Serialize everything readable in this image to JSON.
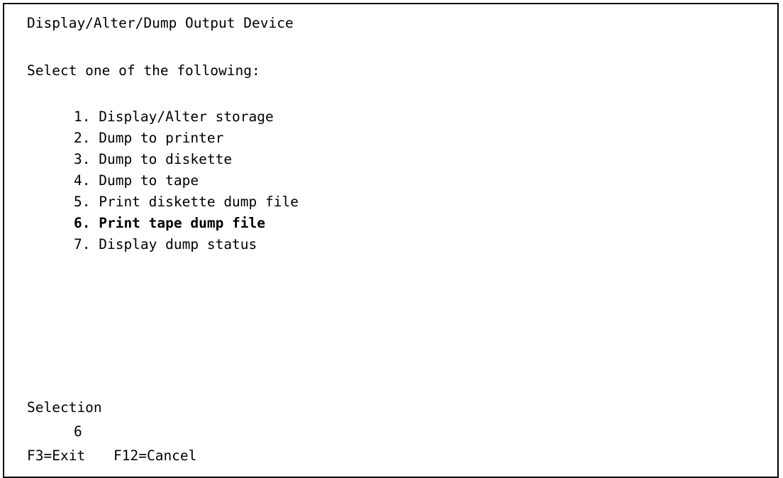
{
  "screen": {
    "title": "Display/Alter/Dump Output Device",
    "prompt": "Select one of the following:",
    "options": [
      {
        "label": "1. Display/Alter storage",
        "selected": false
      },
      {
        "label": "2. Dump to printer",
        "selected": false
      },
      {
        "label": "3. Dump to diskette",
        "selected": false
      },
      {
        "label": "4. Dump to tape",
        "selected": false
      },
      {
        "label": "5. Print diskette dump file",
        "selected": false
      },
      {
        "label": "6. Print tape dump file",
        "selected": true
      },
      {
        "label": "7. Display dump status",
        "selected": false
      }
    ],
    "selection_label": "Selection",
    "selection_value": "6",
    "function_keys": {
      "exit": "F3=Exit",
      "cancel": "F12=Cancel"
    }
  }
}
